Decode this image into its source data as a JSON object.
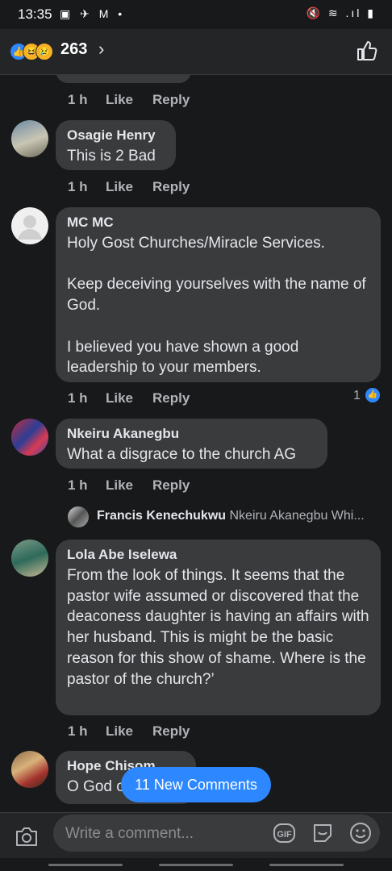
{
  "status_bar": {
    "time": "13:35",
    "left_icons": "▣ ✈ M •",
    "right_icons": "🔇 ≋ .ıl ▮"
  },
  "header": {
    "reaction_count": "263",
    "chevron": "›"
  },
  "reactions": {
    "like_icon": "thumbs-up-icon",
    "haha_icon": "haha-icon",
    "sad_icon": "sad-icon"
  },
  "comments": [
    {
      "time": "1 h",
      "like": "Like",
      "reply": "Reply"
    },
    {
      "name": "Osagie Henry",
      "text": "This is 2 Bad",
      "time": "1 h",
      "like": "Like",
      "reply": "Reply"
    },
    {
      "name": "MC MC",
      "text": "Holy Gost Churches/Miracle Services.\n\nKeep deceiving yourselves with the name of God.\n\nI believed you have shown a good leadership to your members.",
      "time": "1 h",
      "like": "Like",
      "reply": "Reply",
      "like_count": "1"
    },
    {
      "name": "Nkeiru Akanegbu",
      "text": "What a disgrace to the church AG",
      "time": "1 h",
      "like": "Like",
      "reply": "Reply",
      "reply_preview": {
        "author": "Francis Kenechukwu",
        "text": "Nkeiru Akanegbu Whi..."
      }
    },
    {
      "name": "Lola Abe Iselewa",
      "text": "From the look of things. It seems that the pastor wife assumed or discovered that the deaconess daughter is having an affairs with her husband. This is might be the basic reason for this show of shame. Where is the pastor of the church?’",
      "time": "1 h",
      "like": "Like",
      "reply": "Reply"
    },
    {
      "name": "Hope Chisom",
      "text": "O God o"
    }
  ],
  "new_comments_button": "11 New Comments",
  "composer": {
    "placeholder": "Write a comment...",
    "gif_label": "GIF"
  },
  "colors": {
    "accent": "#2d88ff",
    "background": "#18191a",
    "bubble": "#3a3b3c"
  }
}
